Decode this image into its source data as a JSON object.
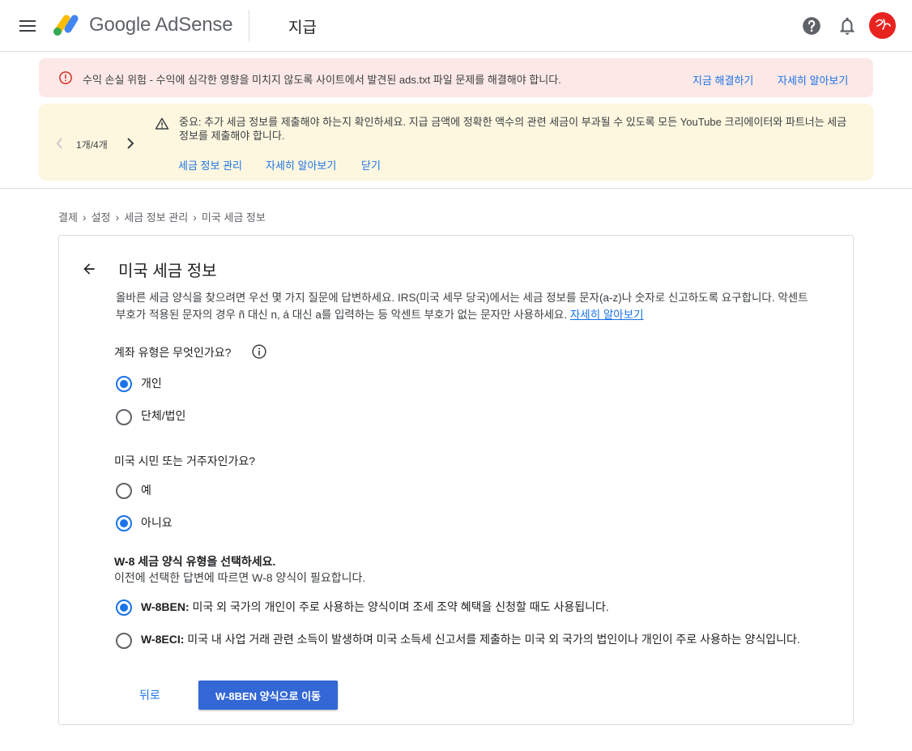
{
  "header": {
    "brand_name": "Google AdSense",
    "page_title": "지급",
    "icons": [
      "menu-icon",
      "adsense-logo",
      "help-icon",
      "bell-icon",
      "avatar"
    ]
  },
  "alerts": {
    "warning": {
      "message": "수익 손실 위험 - 수익에 심각한 영향을 미치지 않도록 사이트에서 발견된 ads.txt 파일 문제를 해결해야 합니다.",
      "fix_link": "지금 해결하기",
      "learn_link": "자세히 알아보기"
    },
    "notice": {
      "pager": "1개/4개",
      "message": "중요: 추가 세금 정보를 제출해야 하는지 확인하세요. 지급 금액에 정확한 액수의 관련 세금이 부과될 수 있도록 모든 YouTube 크리에이터와 파트너는 세금 정보를 제출해야 합니다.",
      "actions": [
        "세금 정보 관리",
        "자세히 알아보기",
        "닫기"
      ]
    }
  },
  "breadcrumb": [
    "결제",
    "설정",
    "세금 정보 관리",
    "미국 세금 정보"
  ],
  "card": {
    "title": "미국 세금 정보",
    "intro": "올바른 세금 양식을 찾으려면 우선 몇 가지 질문에 답변하세요. IRS(미국 세무 당국)에서는 세금 정보를 문자(a-z)나 숫자로 신고하도록 요구합니다. 악센트 부호가 적용된 문자의 경우 ñ 대신 n, á 대신 a를 입력하는 등 악센트 부호가 없는 문자만 사용하세요.",
    "intro_link": "자세히 알아보기",
    "q1": {
      "label": "계좌 유형은 무엇인가요?",
      "options": [
        "개인",
        "단체/법인"
      ],
      "selected": "개인"
    },
    "q2": {
      "label": "미국 시민 또는 거주자인가요?",
      "options": [
        "예",
        "아니요"
      ],
      "selected": "아니요"
    },
    "q3": {
      "heading": "W-8 세금 양식 유형을 선택하세요.",
      "subtext": "이전에 선택한 답변에 따르면 W-8 양식이 필요합니다.",
      "options": [
        {
          "code": "W-8BEN:",
          "desc": "미국 외 국가의 개인이 주로 사용하는 양식이며 조세 조약 혜택을 신청할 때도 사용됩니다."
        },
        {
          "code": "W-8ECI:",
          "desc": "미국 내 사업 거래 관련 소득이 발생하며 미국 소득세 신고서를 제출하는 미국 외 국가의 법인이나 개인이 주로 사용하는 양식입니다."
        }
      ],
      "selected": "W-8BEN"
    },
    "back_button": "뒤로",
    "primary_button": "W-8BEN 양식으로 이동"
  },
  "colors": {
    "accent": "#1a73e8",
    "primary_button": "#3367d6",
    "alert_red_bg": "#fce8e6",
    "alert_yellow_bg": "#fef7e0",
    "error_red": "#d93025"
  }
}
